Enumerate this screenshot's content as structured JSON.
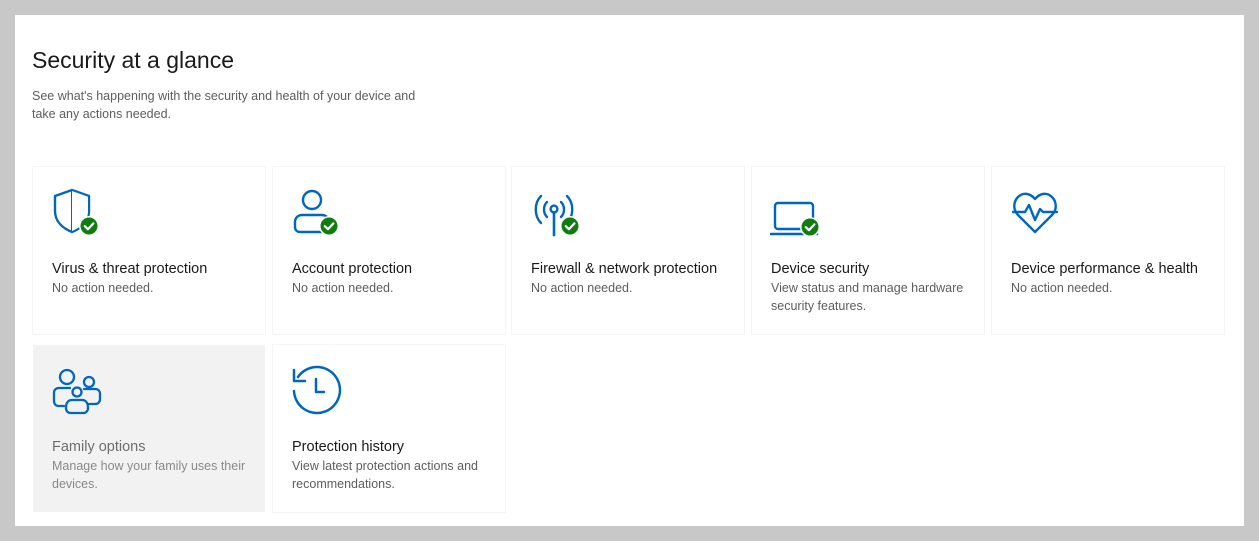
{
  "page": {
    "title": "Security at a glance",
    "subtitle": "See what's happening with the security and health of your device and take any actions needed."
  },
  "colors": {
    "accent": "#0067c0",
    "ok": "#107c10"
  },
  "tiles": [
    {
      "title": "Virus & threat protection",
      "description": "No action needed.",
      "icon": "shield-icon",
      "status": "ok"
    },
    {
      "title": "Account protection",
      "description": "No action needed.",
      "icon": "person-icon",
      "status": "ok"
    },
    {
      "title": "Firewall & network protection",
      "description": "No action needed.",
      "icon": "antenna-icon",
      "status": "ok"
    },
    {
      "title": "Device security",
      "description": "View status and manage hardware security features.",
      "icon": "laptop-icon",
      "status": "ok"
    },
    {
      "title": "Device performance & health",
      "description": "No action needed.",
      "icon": "heart-pulse-icon",
      "status": "none"
    },
    {
      "title": "Family options",
      "description": "Manage how your family uses their devices.",
      "icon": "family-icon",
      "status": "none"
    },
    {
      "title": "Protection history",
      "description": "View latest protection actions and recommendations.",
      "icon": "history-clock-icon",
      "status": "none"
    }
  ]
}
